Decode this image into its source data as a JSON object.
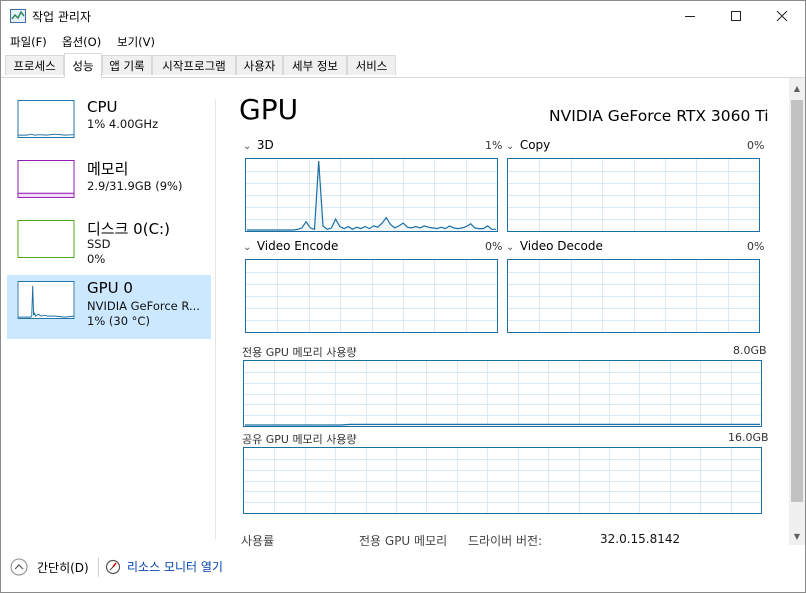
{
  "window": {
    "title": "작업 관리자"
  },
  "menu": [
    "파일(F)",
    "옵션(O)",
    "보기(V)"
  ],
  "tabs": [
    "프로세스",
    "성능",
    "앱 기록",
    "시작프로그램",
    "사용자",
    "세부 정보",
    "서비스"
  ],
  "active_tab": "성능",
  "sidebar": [
    {
      "name": "CPU",
      "line1": "1% 4.00GHz",
      "line2": "",
      "color": "#1a6fa3"
    },
    {
      "name": "메모리",
      "line1": "2.9/31.9GB (9%)",
      "line2": "",
      "color": "#8b12ae"
    },
    {
      "name": "디스크 0(C:)",
      "line1": "SSD",
      "line2": "0%",
      "color": "#4da60c"
    },
    {
      "name": "GPU 0",
      "line1": "NVIDIA GeForce R...",
      "line2": "1% (30 °C)",
      "color": "#1a6fa3"
    }
  ],
  "main": {
    "title": "GPU",
    "model": "NVIDIA GeForce RTX 3060 Ti",
    "engines": [
      {
        "name": "3D",
        "value": "1%"
      },
      {
        "name": "Copy",
        "value": "0%"
      },
      {
        "name": "Video Encode",
        "value": "0%"
      },
      {
        "name": "Video Decode",
        "value": "0%"
      }
    ],
    "dedicated_label": "전용 GPU 메모리 사용량",
    "dedicated_max": "8.0GB",
    "shared_label": "공유 GPU 메모리 사용량",
    "shared_max": "16.0GB",
    "stats": [
      {
        "label": "사용률",
        "value": ""
      },
      {
        "label": "전용 GPU 메모리",
        "value": ""
      },
      {
        "label": "드라이버 버전:",
        "value": "32.0.15.8142"
      }
    ]
  },
  "footer": {
    "fewer_details": "간단히(D)",
    "resource_monitor": "리소스 모니터 열기"
  },
  "chart_data": {
    "type": "line",
    "title": "3D",
    "y_unit": "%",
    "ylim": [
      0,
      100
    ],
    "x": [
      0,
      1,
      2,
      3,
      4,
      5,
      6,
      7,
      8,
      9,
      10,
      11,
      12,
      13,
      14,
      15,
      16,
      17,
      18,
      19,
      20,
      21,
      22,
      23,
      24,
      25,
      26,
      27,
      28,
      29,
      30,
      31,
      32,
      33,
      34,
      35,
      36,
      37,
      38,
      39,
      40,
      41,
      42,
      43,
      44,
      45,
      46,
      47,
      48,
      49,
      50,
      51,
      52,
      53,
      54,
      55,
      56,
      57,
      58,
      59
    ],
    "values": [
      0,
      0,
      0,
      0,
      0,
      0,
      0,
      0,
      0,
      0,
      0,
      0,
      1,
      3,
      12,
      3,
      1,
      100,
      6,
      1,
      3,
      16,
      5,
      2,
      5,
      1,
      4,
      2,
      5,
      2,
      6,
      4,
      10,
      18,
      8,
      3,
      6,
      10,
      4,
      3,
      5,
      3,
      6,
      4,
      3,
      2,
      4,
      2,
      6,
      3,
      2,
      3,
      5,
      9,
      3,
      2,
      2,
      6,
      1,
      1
    ],
    "dedicated_values": [
      0,
      0,
      0,
      0,
      0,
      0,
      0,
      0,
      0,
      0,
      0,
      0,
      1,
      1,
      1,
      1,
      1,
      1,
      1,
      1,
      1,
      1,
      1,
      1,
      1,
      1,
      1,
      1,
      1,
      1,
      1,
      1,
      1,
      1,
      1,
      1,
      1,
      1,
      1,
      1,
      1,
      1,
      1,
      1,
      1,
      1,
      1,
      1,
      1,
      1,
      1,
      1,
      1,
      1,
      1,
      1,
      1,
      1,
      1,
      1
    ],
    "grid": true
  }
}
